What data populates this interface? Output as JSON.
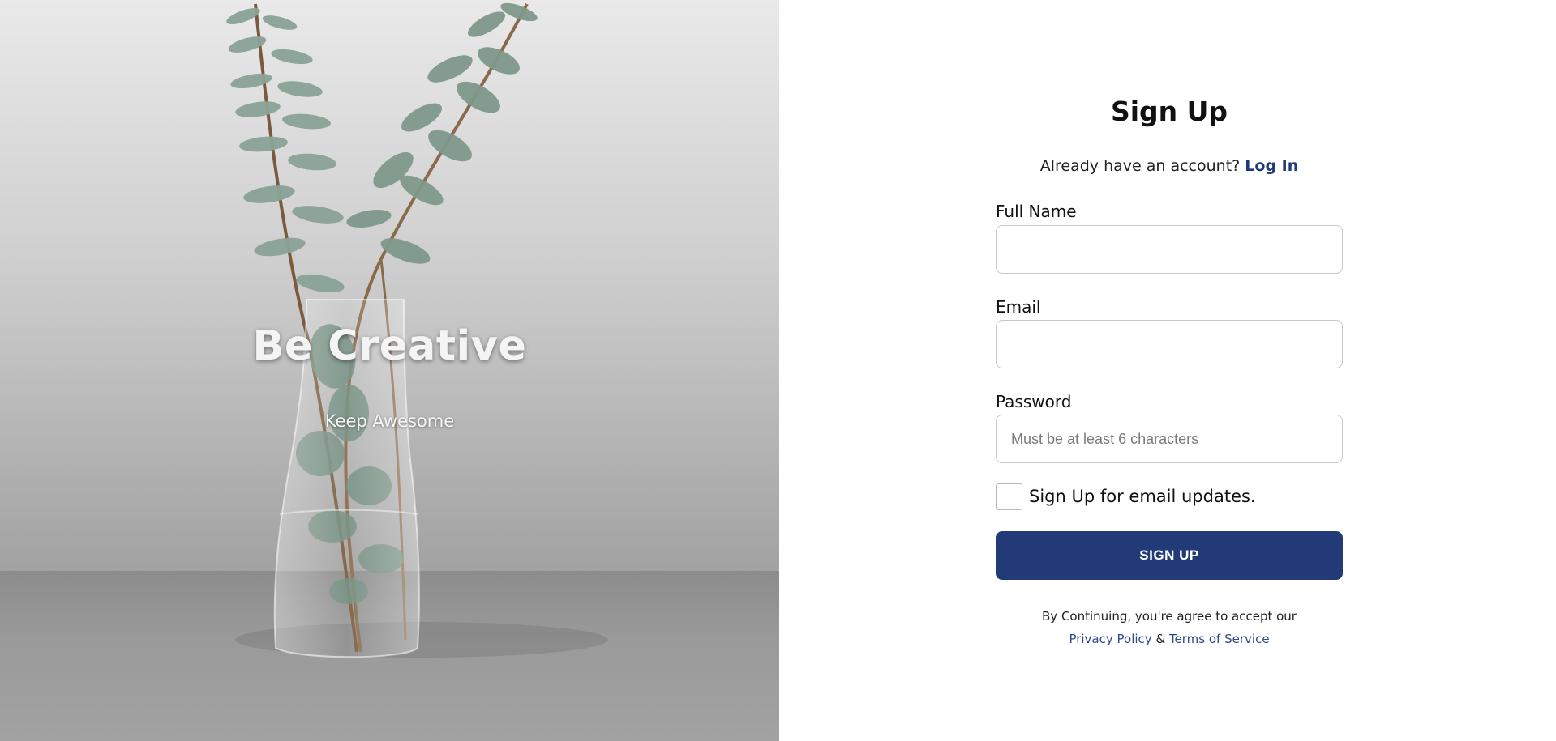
{
  "hero": {
    "title": "Be Creative",
    "subtitle": "Keep Awesome",
    "image": "eucalyptus-branches-in-glass-vase"
  },
  "form": {
    "title": "Sign Up",
    "login_prompt": "Already have an account?",
    "login_link": "Log In",
    "fields": {
      "full_name": {
        "label": "Full Name",
        "value": "",
        "placeholder": ""
      },
      "email": {
        "label": "Email",
        "value": "",
        "placeholder": ""
      },
      "password": {
        "label": "Password",
        "value": "",
        "placeholder": "Must be at least 6 characters"
      }
    },
    "email_updates_label": "Sign Up for email updates.",
    "email_updates_checked": false,
    "submit_label": "SIGN UP",
    "terms_text": "By Continuing, you're agree to accept our",
    "privacy_link": "Privacy Policy",
    "terms_separator": "&",
    "terms_link": "Terms of Service"
  },
  "colors": {
    "accent": "#223a78",
    "link": "#1f3a7a"
  }
}
